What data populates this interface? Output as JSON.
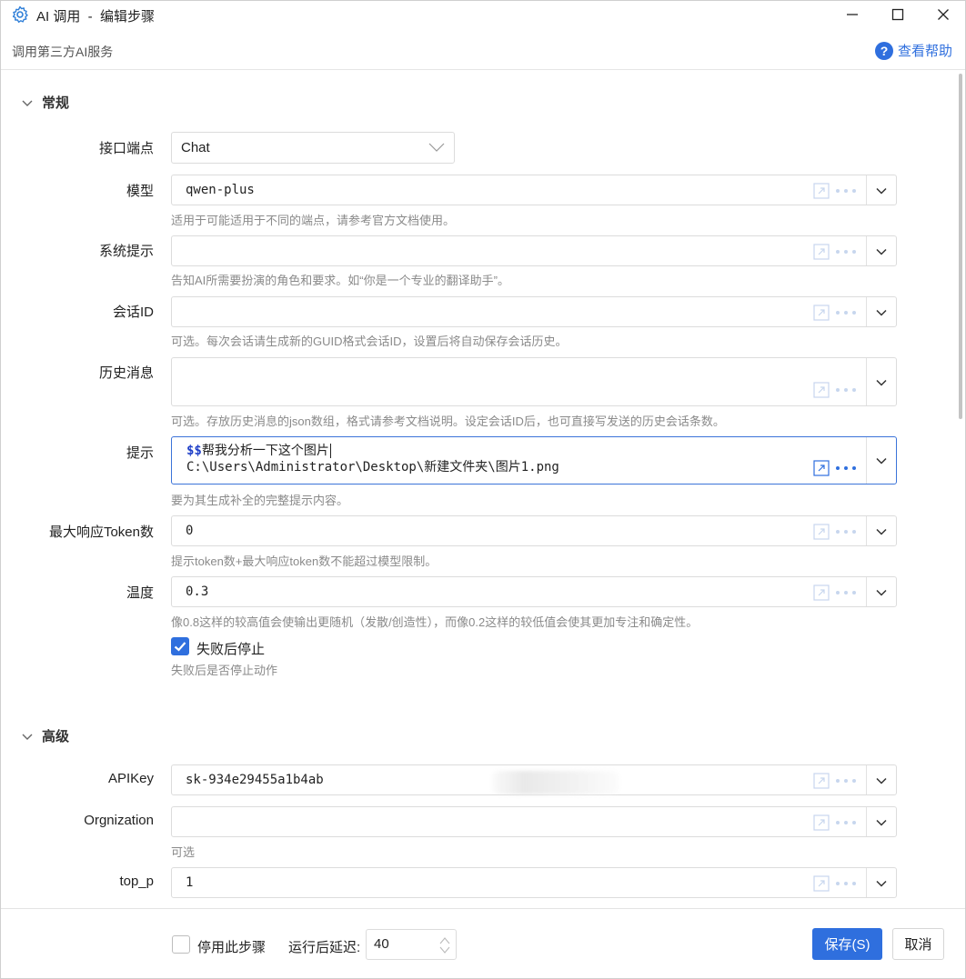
{
  "window": {
    "title": "AI 调用  -  编辑步骤",
    "subtitle": "调用第三方AI服务",
    "help_label": "查看帮助"
  },
  "sections": {
    "general": "常规",
    "advanced": "高级"
  },
  "fields": {
    "endpoint": {
      "label": "接口端点",
      "value": "Chat"
    },
    "model": {
      "label": "模型",
      "value": "qwen-plus",
      "hint": "适用于可能适用于不同的端点，请参考官方文档使用。"
    },
    "system_prompt": {
      "label": "系统提示",
      "value": "",
      "hint": "告知AI所需要扮演的角色和要求。如“你是一个专业的翻译助手”。"
    },
    "session_id": {
      "label": "会话ID",
      "value": "",
      "hint": "可选。每次会话请生成新的GUID格式会话ID，设置后将自动保存会话历史。"
    },
    "history": {
      "label": "历史消息",
      "value": "",
      "hint": "可选。存放历史消息的json数组，格式请参考文档说明。设定会话ID后，也可直接写发送的历史会话条数。"
    },
    "prompt": {
      "label": "提示",
      "var": "$$",
      "line1": "帮我分析一下这个图片",
      "line2": "C:\\Users\\Administrator\\Desktop\\新建文件夹\\图片1.png",
      "hint": "要为其生成补全的完整提示内容。"
    },
    "max_tokens": {
      "label": "最大响应Token数",
      "value": "0",
      "hint": "提示token数+最大响应token数不能超过模型限制。"
    },
    "temperature": {
      "label": "温度",
      "value": "0.3",
      "hint": "像0.8这样的较高值会使输出更随机（发散/创造性），而像0.2这样的较低值会使其更加专注和确定性。"
    },
    "stop_on_fail": {
      "label": "失败后停止",
      "checked": true,
      "hint": "失败后是否停止动作"
    },
    "api_key": {
      "label": "APIKey",
      "value": "sk-934e29455a1b4ab"
    },
    "organization": {
      "label": "Orgnization",
      "value": "",
      "hint": "可选"
    },
    "top_p": {
      "label": "top_p",
      "value": "1"
    }
  },
  "footer": {
    "disable_label": "停用此步骤",
    "disable_checked": false,
    "delay_label": "运行后延迟:",
    "delay_value": "40",
    "save_label": "保存(S)",
    "cancel_label": "取消"
  },
  "colors": {
    "accent": "#2f6fde",
    "hint": "#8a8a8a"
  }
}
